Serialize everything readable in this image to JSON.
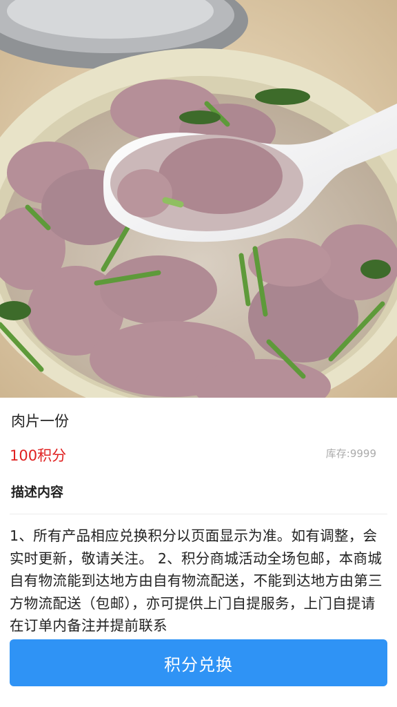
{
  "product": {
    "image_alt": "",
    "name": "肉片一份",
    "price": "100积分",
    "stock_label": "库存:",
    "stock_value": "9999"
  },
  "description": {
    "title": "描述内容",
    "body": "1、所有产品相应兑换积分以页面显示为准。如有调整，会实时更新，敬请关注。 2、积分商城活动全场包邮，本商城自有物流能到达地方由自有物流配送，不能到达地方由第三方物流配送（包邮），亦可提供上门自提服务，上门自提请在订单内备注并提前联系"
  },
  "actions": {
    "redeem_label": "积分兑换"
  },
  "colors": {
    "price": "#e02020",
    "button": "#2f93f5"
  }
}
